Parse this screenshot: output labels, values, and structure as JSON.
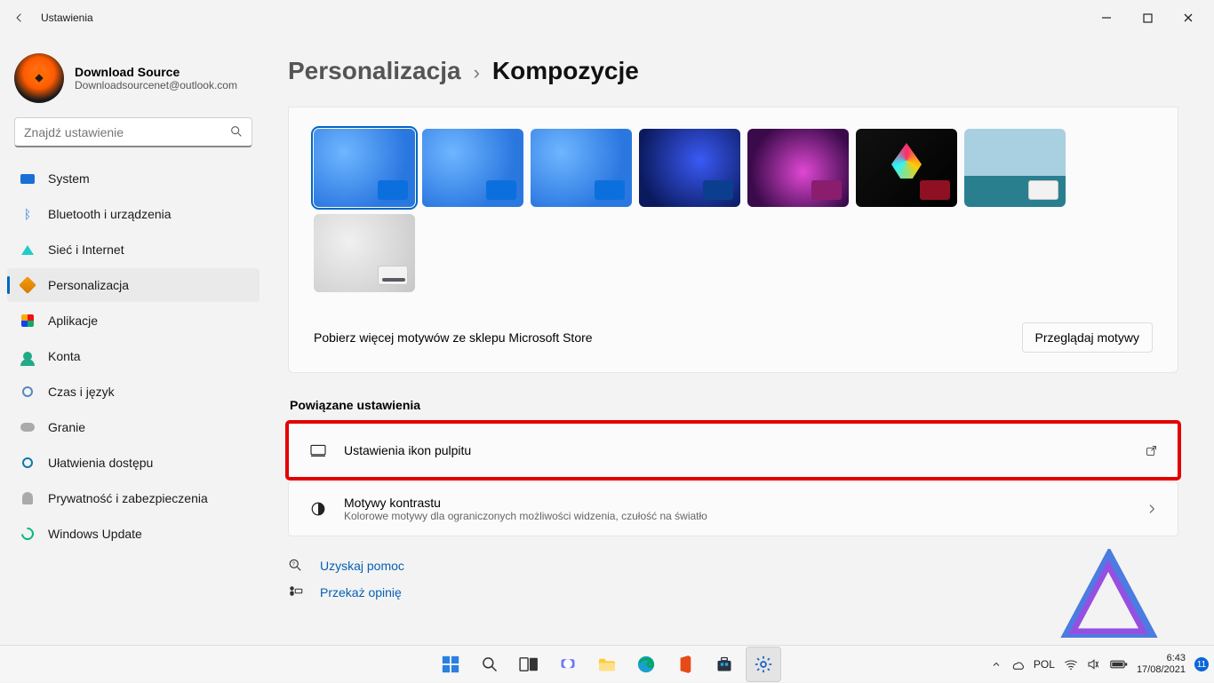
{
  "window": {
    "title": "Ustawienia"
  },
  "user": {
    "name": "Download Source",
    "email": "Downloadsourcenet@outlook.com"
  },
  "search": {
    "placeholder": "Znajdź ustawienie"
  },
  "sidebar": {
    "items": [
      {
        "label": "System"
      },
      {
        "label": "Bluetooth i urządzenia"
      },
      {
        "label": "Sieć i Internet"
      },
      {
        "label": "Personalizacja"
      },
      {
        "label": "Aplikacje"
      },
      {
        "label": "Konta"
      },
      {
        "label": "Czas i język"
      },
      {
        "label": "Granie"
      },
      {
        "label": "Ułatwienia dostępu"
      },
      {
        "label": "Prywatność i zabezpieczenia"
      },
      {
        "label": "Windows Update"
      }
    ],
    "selected_index": 3
  },
  "breadcrumb": {
    "parent": "Personalizacja",
    "sep": "›",
    "page": "Kompozycje"
  },
  "store_row": {
    "text": "Pobierz więcej motywów ze sklepu Microsoft Store",
    "button": "Przeglądaj motywy"
  },
  "section_related": "Powiązane ustawienia",
  "related": [
    {
      "title": "Ustawienia ikon pulpitu"
    },
    {
      "title": "Motywy kontrastu",
      "subtitle": "Kolorowe motywy dla ograniczonych możliwości widzenia, czułość na światło"
    }
  ],
  "links": {
    "help": "Uzyskaj pomoc",
    "feedback": "Przekaż opinię"
  },
  "tray": {
    "lang": "POL",
    "time": "6:43",
    "date": "17/08/2021",
    "badge": "11"
  }
}
